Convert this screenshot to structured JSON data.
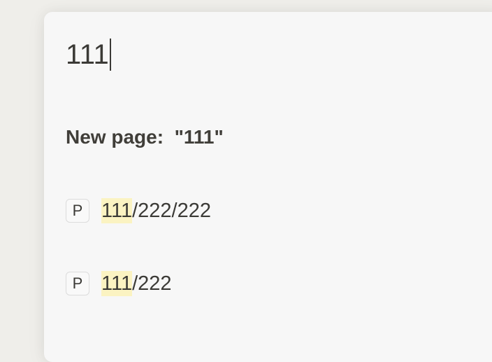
{
  "search": {
    "value": "111"
  },
  "new_page": {
    "label": "New page:  \"111\""
  },
  "results": [
    {
      "badge": "P",
      "match": "111",
      "rest": "/222/222"
    },
    {
      "badge": "P",
      "match": "111",
      "rest": "/222"
    }
  ],
  "colors": {
    "background": "#efeeea",
    "panel": "#f7f7f7",
    "text": "#3b3a36",
    "highlight": "#fbf3c2"
  }
}
